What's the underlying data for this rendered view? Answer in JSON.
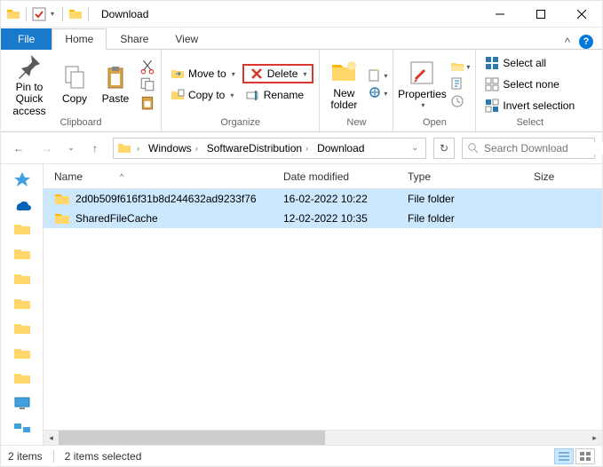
{
  "window": {
    "title": "Download"
  },
  "tabs": {
    "file": "File",
    "home": "Home",
    "share": "Share",
    "view": "View"
  },
  "ribbon": {
    "clipboard": {
      "label": "Clipboard",
      "pin": "Pin to Quick\naccess",
      "copy": "Copy",
      "paste": "Paste"
    },
    "organize": {
      "label": "Organize",
      "moveto": "Move to",
      "copyto": "Copy to",
      "delete": "Delete",
      "rename": "Rename"
    },
    "new": {
      "label": "New",
      "newfolder": "New\nfolder"
    },
    "open": {
      "label": "Open",
      "properties": "Properties"
    },
    "select": {
      "label": "Select",
      "all": "Select all",
      "none": "Select none",
      "invert": "Invert selection"
    }
  },
  "breadcrumbs": [
    "Windows",
    "SoftwareDistribution",
    "Download"
  ],
  "search": {
    "placeholder": "Search Download"
  },
  "columns": {
    "name": "Name",
    "date": "Date modified",
    "type": "Type",
    "size": "Size"
  },
  "files": [
    {
      "name": "2d0b509f616f31b8d244632ad9233f76",
      "date": "16-02-2022 10:22",
      "type": "File folder"
    },
    {
      "name": "SharedFileCache",
      "date": "12-02-2022 10:35",
      "type": "File folder"
    }
  ],
  "status": {
    "count": "2 items",
    "selected": "2 items selected"
  }
}
